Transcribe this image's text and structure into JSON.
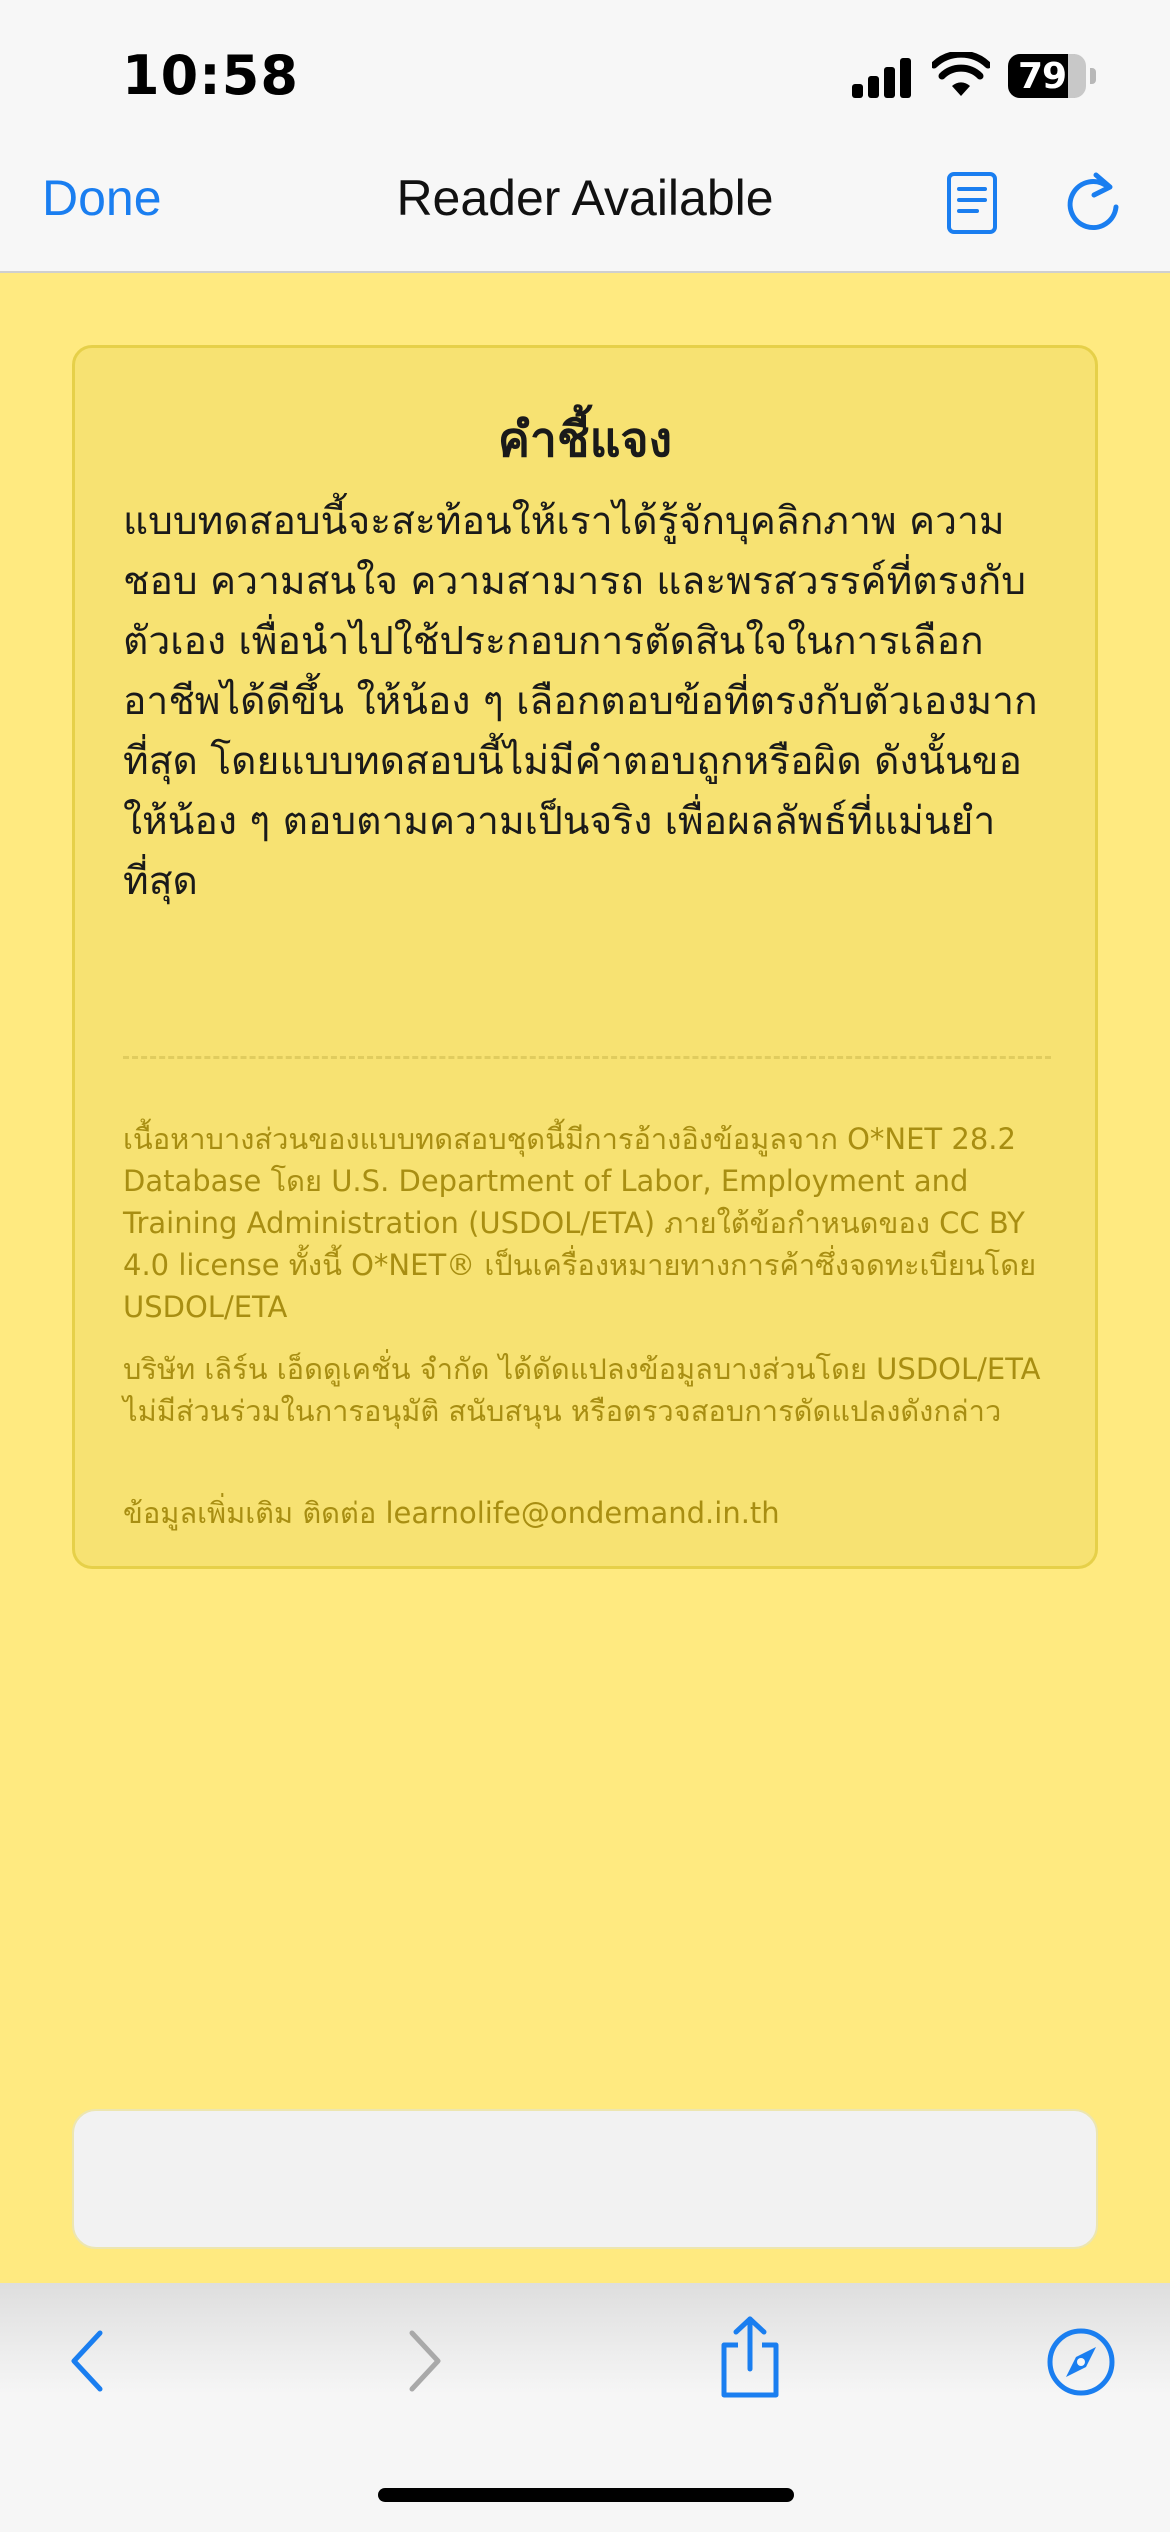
{
  "status_bar": {
    "time": "10:58",
    "battery": "79"
  },
  "nav": {
    "done_label": "Done",
    "title": "Reader Available"
  },
  "card": {
    "title": "คำชี้แจง",
    "body": "แบบทดสอบนี้จะสะท้อนให้เราได้รู้จักบุคลิกภาพ ความชอบ ความสนใจ ความสามารถ และพรสวรรค์ที่ตรงกับตัวเอง เพื่อนำไปใช้ประกอบการตัดสินใจในการเลือกอาชีพได้ดีขึ้น ให้น้อง ๆ เลือกตอบข้อที่ตรงกับตัวเองมากที่สุด โดยแบบทดสอบนี้ไม่มีคำตอบถูกหรือผิด ดังนั้นขอให้น้อง ๆ ตอบตามความเป็นจริง เพื่อผลลัพธ์ที่แม่นยำที่สุด",
    "note_license": "เนื้อหาบางส่วนของแบบทดสอบชุดนี้มีการอ้างอิงข้อมูลจาก O*NET 28.2 Database โดย U.S. Department of Labor, Employment and Training Administration (USDOL/ETA) ภายใต้ข้อกำหนดของ CC BY 4.0 license ทั้งนี้ O*NET® เป็นเครื่องหมายทางการค้าซึ่งจดทะเบียนโดย USDOL/ETA",
    "note_modification": "บริษัท เลิร์น เอ็ดดูเคชั่น จำกัด ได้ดัดแปลงข้อมูลบางส่วนโดย USDOL/ETA ไม่มีส่วนร่วมในการอนุมัติ สนับสนุน หรือตรวจสอบการดัดแปลงดังกล่าว",
    "note_contact": "ข้อมูลเพิ่มเติม ติดต่อ learnolife@ondemand.in.th"
  },
  "toolbar": {
    "icons": [
      "back-icon",
      "forward-icon",
      "share-icon",
      "compass-icon"
    ]
  },
  "colors": {
    "accent": "#1a7ef0",
    "page_bg": "#ffea80",
    "card_bg": "#f7e272",
    "note_text": "#a88e12"
  }
}
